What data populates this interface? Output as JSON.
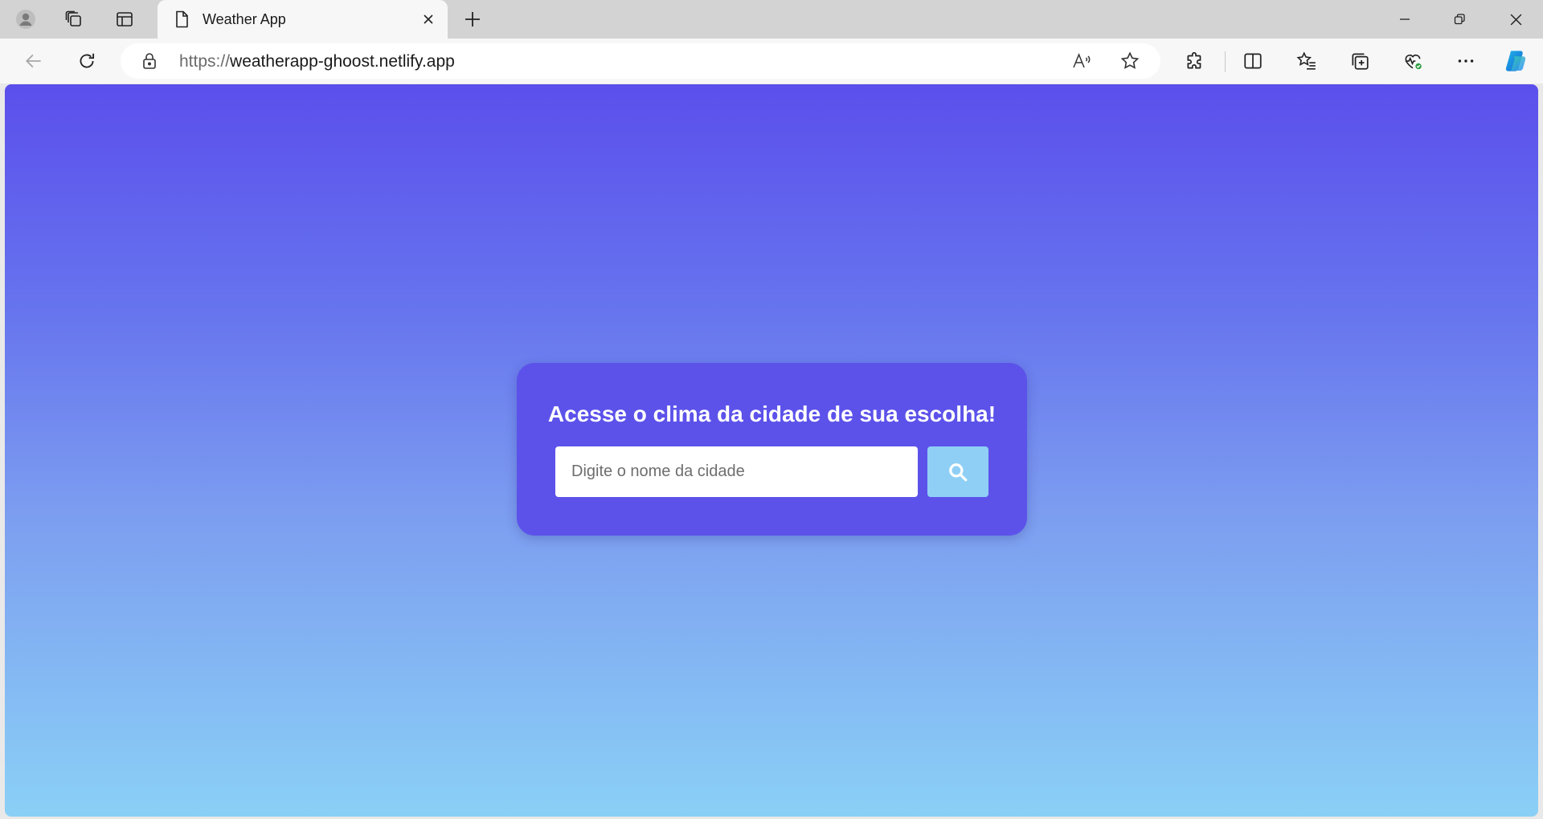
{
  "browser": {
    "tab": {
      "title": "Weather App"
    },
    "address": {
      "scheme": "https://",
      "host": "weatherapp-ghoost.netlify.app"
    },
    "icons": {
      "profile": "profile-avatar-icon",
      "workspaces": "workspaces-icon",
      "vertical_tabs": "vertical-tabs-icon",
      "new_tab": "plus-icon",
      "back": "back-arrow-icon",
      "refresh": "refresh-icon",
      "read_aloud": "read-aloud-icon",
      "favorite": "star-icon",
      "extensions": "puzzle-icon",
      "split_screen": "split-screen-icon",
      "favorites": "favorites-list-icon",
      "collections": "collections-icon",
      "browser_essentials": "heart-pulse-icon",
      "more": "ellipsis-icon",
      "copilot": "copilot-icon"
    }
  },
  "app": {
    "title": "Acesse o clima da cidade de sua escolha!",
    "search": {
      "placeholder": "Digite o nome da cidade",
      "button_icon": "search-icon"
    },
    "colors": {
      "gradient_top": "#5b4fec",
      "gradient_bottom": "#8ad0f6",
      "card": "#5c52ea",
      "button": "#8fcff5"
    }
  }
}
